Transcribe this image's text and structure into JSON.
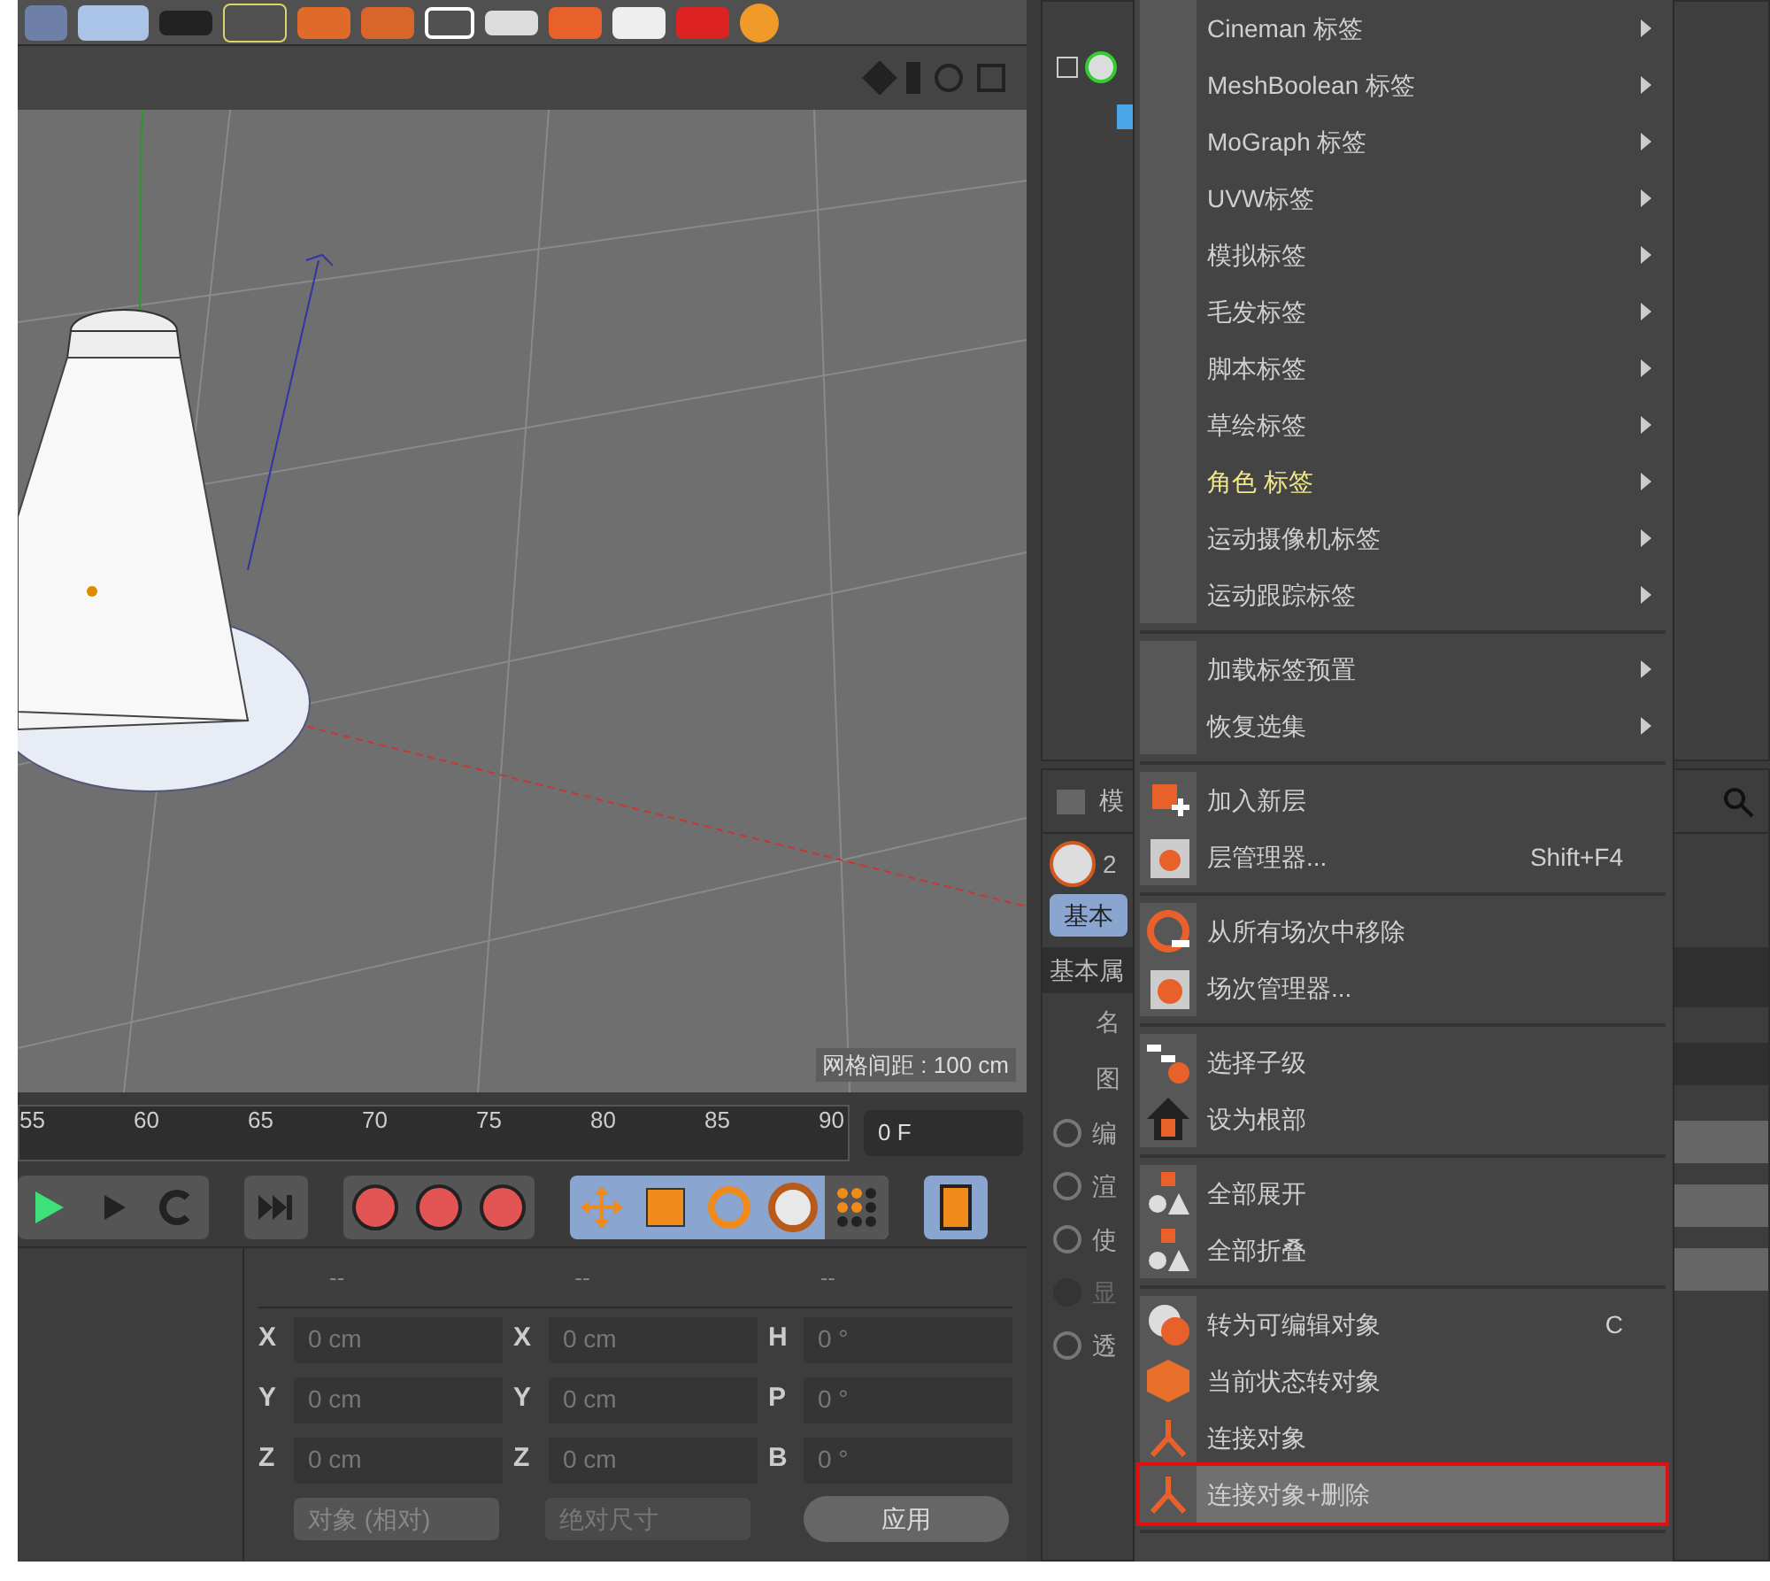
{
  "viewport": {
    "grid_label": "网格间距 : 100 cm"
  },
  "timeline": {
    "ticks": [
      "55",
      "60",
      "65",
      "70",
      "75",
      "80",
      "85",
      "90"
    ],
    "frame_field": "0 F"
  },
  "coordinates": {
    "headers": [
      "--",
      "--",
      "--"
    ],
    "rows": [
      [
        {
          "axis": "X",
          "value": "0 cm"
        },
        {
          "axis": "X",
          "value": "0 cm"
        },
        {
          "axis": "H",
          "value": "0 °"
        }
      ],
      [
        {
          "axis": "Y",
          "value": "0 cm"
        },
        {
          "axis": "Y",
          "value": "0 cm"
        },
        {
          "axis": "P",
          "value": "0 °"
        }
      ],
      [
        {
          "axis": "Z",
          "value": "0 cm"
        },
        {
          "axis": "Z",
          "value": "0 cm"
        },
        {
          "axis": "B",
          "value": "0 °"
        }
      ]
    ],
    "mode_dropdown": "对象 (相对)",
    "size_dropdown": "绝对尺寸",
    "apply_button": "应用"
  },
  "attributes": {
    "panel_title": "模",
    "object_label": "2",
    "tabs": [
      {
        "label": "基本",
        "selected": true
      }
    ],
    "section": "基本属",
    "fields": [
      "名",
      "图"
    ],
    "radios": [
      {
        "label": "编",
        "disabled": false
      },
      {
        "label": "渲",
        "disabled": false
      },
      {
        "label": "使",
        "disabled": false
      },
      {
        "label": "显",
        "disabled": true
      },
      {
        "label": "透",
        "disabled": false
      }
    ]
  },
  "menu": {
    "items": [
      {
        "kind": "item",
        "label": "Cineman 标签",
        "submenu": true,
        "emphasized": false,
        "selected": false
      },
      {
        "kind": "item",
        "label": "MeshBoolean 标签",
        "submenu": true,
        "emphasized": false,
        "selected": false
      },
      {
        "kind": "item",
        "label": "MoGraph 标签",
        "submenu": true,
        "emphasized": false,
        "selected": false
      },
      {
        "kind": "item",
        "label": "UVW标签",
        "submenu": true,
        "emphasized": false,
        "selected": false
      },
      {
        "kind": "item",
        "label": "模拟标签",
        "submenu": true,
        "emphasized": false,
        "selected": false
      },
      {
        "kind": "item",
        "label": "毛发标签",
        "submenu": true,
        "emphasized": false,
        "selected": false
      },
      {
        "kind": "item",
        "label": "脚本标签",
        "submenu": true,
        "emphasized": false,
        "selected": false
      },
      {
        "kind": "item",
        "label": "草绘标签",
        "submenu": true,
        "emphasized": false,
        "selected": false
      },
      {
        "kind": "item",
        "label": "角色 标签",
        "submenu": true,
        "emphasized": true,
        "selected": false
      },
      {
        "kind": "item",
        "label": "运动摄像机标签",
        "submenu": true,
        "emphasized": false,
        "selected": false
      },
      {
        "kind": "item",
        "label": "运动跟踪标签",
        "submenu": true,
        "emphasized": false,
        "selected": false
      },
      {
        "kind": "separator"
      },
      {
        "kind": "item",
        "label": "加载标签预置",
        "submenu": true,
        "emphasized": false,
        "selected": false
      },
      {
        "kind": "item",
        "label": "恢复选集",
        "submenu": true,
        "emphasized": false,
        "selected": false
      },
      {
        "kind": "separator"
      },
      {
        "kind": "item",
        "label": "加入新层",
        "submenu": false,
        "emphasized": false,
        "selected": false
      },
      {
        "kind": "item",
        "label": "层管理器...",
        "shortcut": "Shift+F4",
        "submenu": false,
        "emphasized": false,
        "selected": false
      },
      {
        "kind": "separator"
      },
      {
        "kind": "item",
        "label": "从所有场次中移除",
        "submenu": false,
        "emphasized": false,
        "selected": false
      },
      {
        "kind": "item",
        "label": "场次管理器...",
        "submenu": false,
        "emphasized": false,
        "selected": false
      },
      {
        "kind": "separator"
      },
      {
        "kind": "item",
        "label": "选择子级",
        "submenu": false,
        "emphasized": false,
        "selected": false
      },
      {
        "kind": "item",
        "label": "设为根部",
        "submenu": false,
        "emphasized": false,
        "selected": false
      },
      {
        "kind": "separator"
      },
      {
        "kind": "item",
        "label": "全部展开",
        "submenu": false,
        "emphasized": false,
        "selected": false
      },
      {
        "kind": "item",
        "label": "全部折叠",
        "submenu": false,
        "emphasized": false,
        "selected": false
      },
      {
        "kind": "separator"
      },
      {
        "kind": "item",
        "label": "转为可编辑对象",
        "shortcut": "C",
        "submenu": false,
        "emphasized": false,
        "selected": false
      },
      {
        "kind": "item",
        "label": "当前状态转对象",
        "submenu": false,
        "emphasized": false,
        "selected": false
      },
      {
        "kind": "item",
        "label": "连接对象",
        "submenu": false,
        "emphasized": false,
        "selected": false
      },
      {
        "kind": "item",
        "label": "连接对象+删除",
        "submenu": false,
        "emphasized": false,
        "selected": true
      },
      {
        "kind": "separator"
      }
    ]
  }
}
